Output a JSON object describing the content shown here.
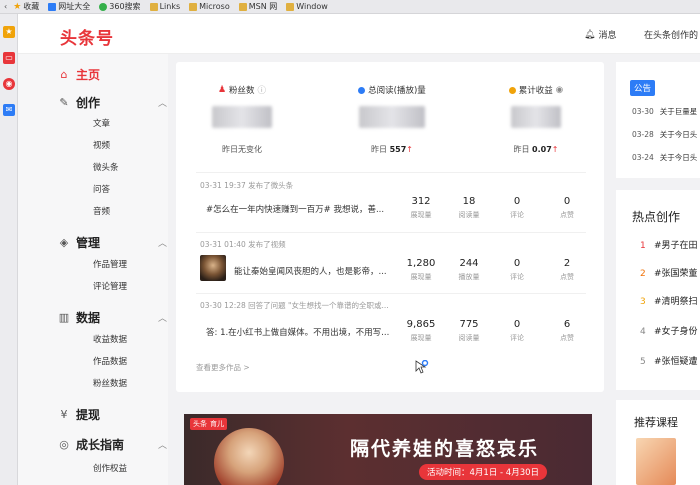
{
  "bookmarks": [
    {
      "label": "收藏",
      "color": "#f0a30a"
    },
    {
      "label": "网址大全",
      "color": "#2d7cf6"
    },
    {
      "label": "360搜索",
      "color": "#35b04b"
    },
    {
      "label": "Links",
      "color": "#e0b040"
    },
    {
      "label": "Microso",
      "color": "#e0b040"
    },
    {
      "label": "MSN 网",
      "color": "#e0b040"
    },
    {
      "label": "Window",
      "color": "#e0b040"
    }
  ],
  "header": {
    "logo": "头条号",
    "message": "消息",
    "creator_link": "在头条创作的"
  },
  "nav": {
    "home": "主页",
    "create": "创作",
    "create_subs": [
      "文章",
      "视频",
      "微头条",
      "问答",
      "音频"
    ],
    "manage": "管理",
    "manage_subs": [
      "作品管理",
      "评论管理"
    ],
    "data": "数据",
    "data_subs": [
      "收益数据",
      "作品数据",
      "粉丝数据"
    ],
    "withdraw": "提现",
    "growth": "成长指南",
    "growth_subs": [
      "创作权益"
    ]
  },
  "stats": [
    {
      "label": "粉丝数",
      "value": "",
      "sub": "昨日无变化",
      "sub_value": "",
      "arrow": ""
    },
    {
      "label": "总阅读(播放)量",
      "value": "",
      "sub": "昨日",
      "sub_value": "557",
      "arrow": "↑"
    },
    {
      "label": "累计收益",
      "value": "",
      "sub": "昨日",
      "sub_value": "0.07",
      "arrow": "↑"
    }
  ],
  "posts": [
    {
      "meta": "03-31 19:37  发布了微头条",
      "text": "#怎么在一年内快速赚到一百万# 我想说，善...",
      "metrics": [
        {
          "n": "312",
          "l": "展现量"
        },
        {
          "n": "18",
          "l": "阅读量"
        },
        {
          "n": "0",
          "l": "评论"
        },
        {
          "n": "0",
          "l": "点赞"
        }
      ]
    },
    {
      "meta": "03-31 01:40  发布了视频",
      "text": "能让秦始皇闻风丧胆的人，也是影帝，...",
      "metrics": [
        {
          "n": "1,280",
          "l": "展现量"
        },
        {
          "n": "244",
          "l": "播放量"
        },
        {
          "n": "0",
          "l": "评论"
        },
        {
          "n": "2",
          "l": "点赞"
        }
      ]
    },
    {
      "meta": "03-30 12:28  回答了问题 \"女生想找一个靠谱的全职或...",
      "text": "答: 1.在小红书上做自媒体。不用出境，不用写...",
      "metrics": [
        {
          "n": "9,865",
          "l": "展现量"
        },
        {
          "n": "775",
          "l": "阅读量"
        },
        {
          "n": "0",
          "l": "评论"
        },
        {
          "n": "6",
          "l": "点赞"
        }
      ]
    }
  ],
  "more_link": "查看更多作品 >",
  "banner": {
    "badge_a": "头条",
    "badge_b": "育儿",
    "title": "隔代养娃的喜怒哀乐",
    "date": "活动时间：4月1日 - 4月30日"
  },
  "notices": {
    "tab": "公告",
    "items": [
      {
        "date": "03-30",
        "text": "关于巨量星"
      },
      {
        "date": "03-28",
        "text": "关于今日头"
      },
      {
        "date": "03-24",
        "text": "关于今日头"
      }
    ]
  },
  "hot": {
    "title": "热点创作",
    "items": [
      {
        "rank": "1",
        "text": "#男子在田"
      },
      {
        "rank": "2",
        "text": "#张国荣董"
      },
      {
        "rank": "3",
        "text": "#清明祭扫"
      },
      {
        "rank": "4",
        "text": "#女子身份"
      },
      {
        "rank": "5",
        "text": "#张恒疑遭"
      }
    ]
  },
  "recommend": {
    "title": "推荐课程"
  },
  "colors": {
    "brand": "#e8353a",
    "accent": "#2d7cf6"
  }
}
